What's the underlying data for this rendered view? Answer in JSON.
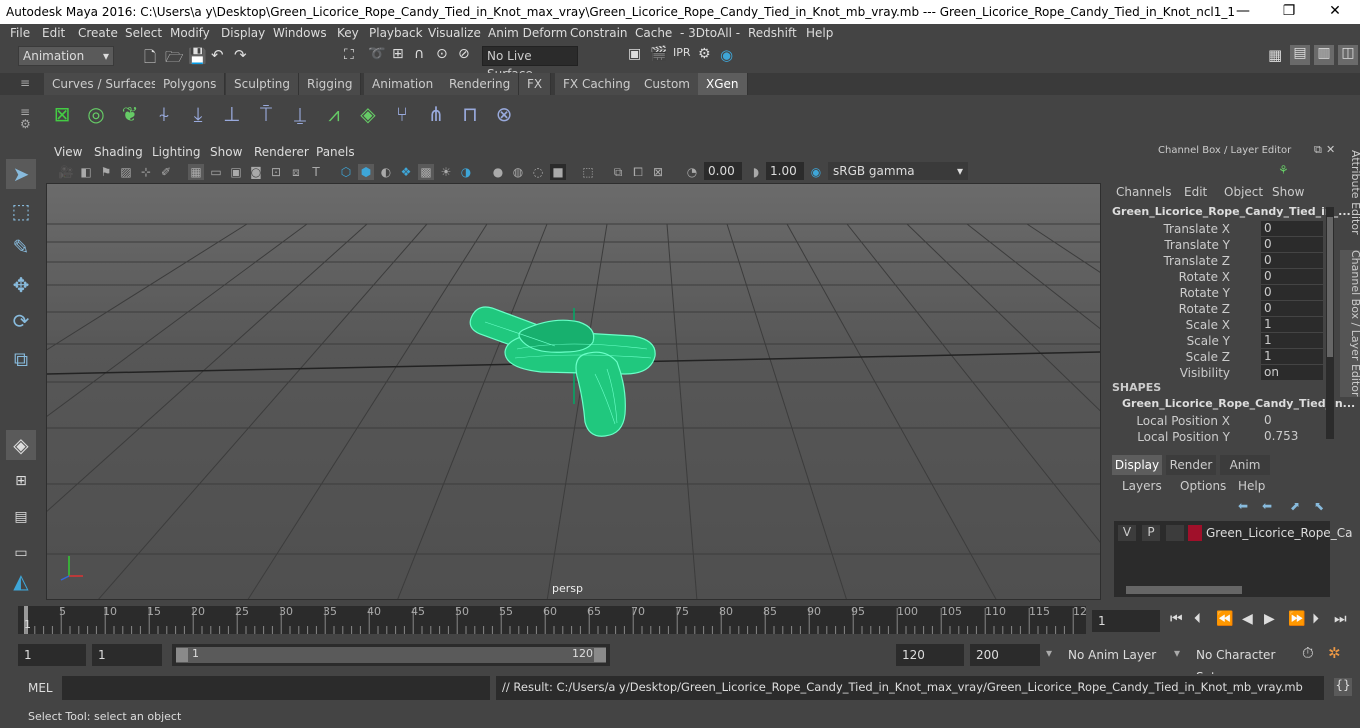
{
  "window": {
    "title": "Autodesk Maya 2016: C:\\Users\\a y\\Desktop\\Green_Licorice_Rope_Candy_Tied_in_Knot_max_vray\\Green_Licorice_Rope_Candy_Tied_in_Knot_mb_vray.mb   ---   Green_Licorice_Rope_Candy_Tied_in_Knot_ncl1_1",
    "minimize": "—",
    "maximize": "❐",
    "close": "✕"
  },
  "menubar": [
    "File",
    "Edit",
    "Create",
    "Select",
    "Modify",
    "Display",
    "Windows",
    "Key",
    "Playback",
    "Visualize",
    "Anim Deform",
    "Constrain",
    "Cache",
    "- 3DtoAll -",
    "Redshift",
    "Help"
  ],
  "statusline": {
    "menuset": "Animation",
    "live_surface": "No Live Surface"
  },
  "shelf_tabs": [
    "Curves / Surfaces",
    "Polygons",
    "Sculpting",
    "Rigging",
    "Animation",
    "Rendering",
    "FX",
    "FX Caching",
    "Custom",
    "XGen"
  ],
  "active_shelf_tab": "XGen",
  "viewport": {
    "menu": [
      "View",
      "Shading",
      "Lighting",
      "Show",
      "Renderer",
      "Panels"
    ],
    "field1": "0.00",
    "field2": "1.00",
    "color_space": "sRGB gamma",
    "camera_label": "persp"
  },
  "channel_box": {
    "title": "Channel Box / Layer Editor",
    "menu": [
      "Channels",
      "Edit",
      "Object",
      "Show"
    ],
    "object_name": "Green_Licorice_Rope_Candy_Tied_in_...",
    "channels": [
      {
        "label": "Translate X",
        "value": "0"
      },
      {
        "label": "Translate Y",
        "value": "0"
      },
      {
        "label": "Translate Z",
        "value": "0"
      },
      {
        "label": "Rotate X",
        "value": "0"
      },
      {
        "label": "Rotate Y",
        "value": "0"
      },
      {
        "label": "Rotate Z",
        "value": "0"
      },
      {
        "label": "Scale X",
        "value": "1"
      },
      {
        "label": "Scale Y",
        "value": "1"
      },
      {
        "label": "Scale Z",
        "value": "1"
      },
      {
        "label": "Visibility",
        "value": "on"
      }
    ],
    "shapes_header": "SHAPES",
    "shape_name": "Green_Licorice_Rope_Candy_Tied_in...",
    "shape_channels": [
      {
        "label": "Local Position X",
        "value": "0"
      },
      {
        "label": "Local Position Y",
        "value": "0.753"
      }
    ]
  },
  "layer_editor": {
    "tabs": [
      "Display",
      "Render",
      "Anim"
    ],
    "active_tab": "Display",
    "menu": [
      "Layers",
      "Options",
      "Help"
    ],
    "layer": {
      "v": "V",
      "p": "P",
      "name": "Green_Licorice_Rope_Ca",
      "color": "#a0102a"
    }
  },
  "side_tabs": [
    "Attribute Editor",
    "Channel Box / Layer Editor"
  ],
  "timeline": {
    "ticks": [
      "5",
      "10",
      "15",
      "20",
      "25",
      "30",
      "35",
      "40",
      "45",
      "50",
      "55",
      "60",
      "65",
      "70",
      "75",
      "80",
      "85",
      "90",
      "95",
      "100",
      "105",
      "110",
      "115",
      "12"
    ],
    "start_label": "1",
    "current_frame": "1"
  },
  "range": {
    "start": "1",
    "playback_start": "1",
    "slider_start": "1",
    "slider_end": "120",
    "playback_end": "120",
    "end": "200",
    "anim_layer": "No Anim Layer",
    "character_set": "No Character Set"
  },
  "command": {
    "label": "MEL",
    "result": "// Result: C:/Users/a y/Desktop/Green_Licorice_Rope_Candy_Tied_in_Knot_max_vray/Green_Licorice_Rope_Candy_Tied_in_Knot_mb_vray.mb"
  },
  "help_line": "Select Tool: select an object",
  "colors": {
    "accent": "#3ea6d8",
    "mesh": "#19e6a0",
    "bg": "#444444"
  }
}
